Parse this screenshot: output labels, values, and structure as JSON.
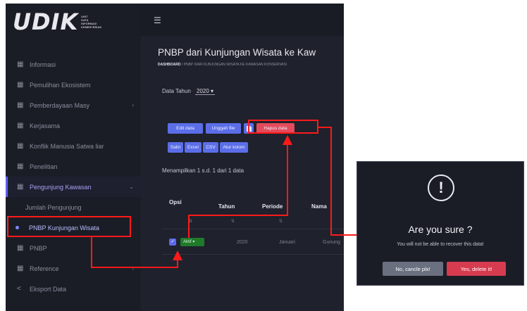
{
  "app": {
    "logo_text": "UDIK",
    "logo_sub": [
      "UNIT",
      "DATA",
      "INFORMASI",
      "KEMENTERIAN"
    ]
  },
  "sidebar": {
    "items": [
      {
        "label": "Informasi",
        "icon": "grid-icon"
      },
      {
        "label": "Pemulihan Ekosistem",
        "icon": "grid-icon"
      },
      {
        "label": "Pemberdayaan Masy",
        "icon": "grid-icon",
        "chevron": true
      },
      {
        "label": "Kerjasama",
        "icon": "grid-icon"
      },
      {
        "label": "Konflik Manusia Satwa liar",
        "icon": "grid-icon"
      },
      {
        "label": "Penelitian",
        "icon": "grid-icon"
      },
      {
        "label": "Pengunjung Kawasan",
        "icon": "grid-icon",
        "chevron": true,
        "active": true
      },
      {
        "label": "Jumlah Pengunjung",
        "sub": true
      },
      {
        "label": "PNBP Kunjungan Wisata",
        "sub": true,
        "current": true
      },
      {
        "label": "PNBP",
        "icon": "grid-icon"
      },
      {
        "label": "Reference",
        "icon": "grid-icon",
        "chevron": true
      },
      {
        "label": "Eksport Data",
        "icon": "share-icon"
      }
    ]
  },
  "main": {
    "menu_icon": "☰",
    "title": "PNBP dari Kunjungan Wisata ke Kaw",
    "breadcrumb_home": "DASHBOARD",
    "breadcrumb_rest": "/ PNBP DARI KUNJUNGAN WISATA KE KAWASAN KONSERVASI",
    "year_label": "Data Tahun",
    "year_value": "2020 ▾",
    "buttons_row1": [
      "Edit data",
      "Unggah file",
      "",
      "Hapus data"
    ],
    "buttons_row2": [
      "Salin",
      "Excel",
      "CSV",
      "Atur kolom"
    ],
    "showing": "Menampilkan 1 s.d. 1 dari 1 data",
    "columns": [
      "Opsi",
      "Tahun",
      "Periode",
      "Nama"
    ],
    "row": {
      "status": "Aktif ▾",
      "tahun": "2020",
      "periode": "Januari",
      "nama": "Gunung"
    }
  },
  "modal": {
    "icon": "!",
    "title": "Are you sure ?",
    "text": "You will not be able to recover this data!",
    "cancel_label": "No, cancle plx!",
    "confirm_label": "Yes, delete it!"
  },
  "colors": {
    "highlight": "#ff1a1a",
    "primary_button": "#5b6ee8",
    "danger_button": "#e34b5d"
  }
}
